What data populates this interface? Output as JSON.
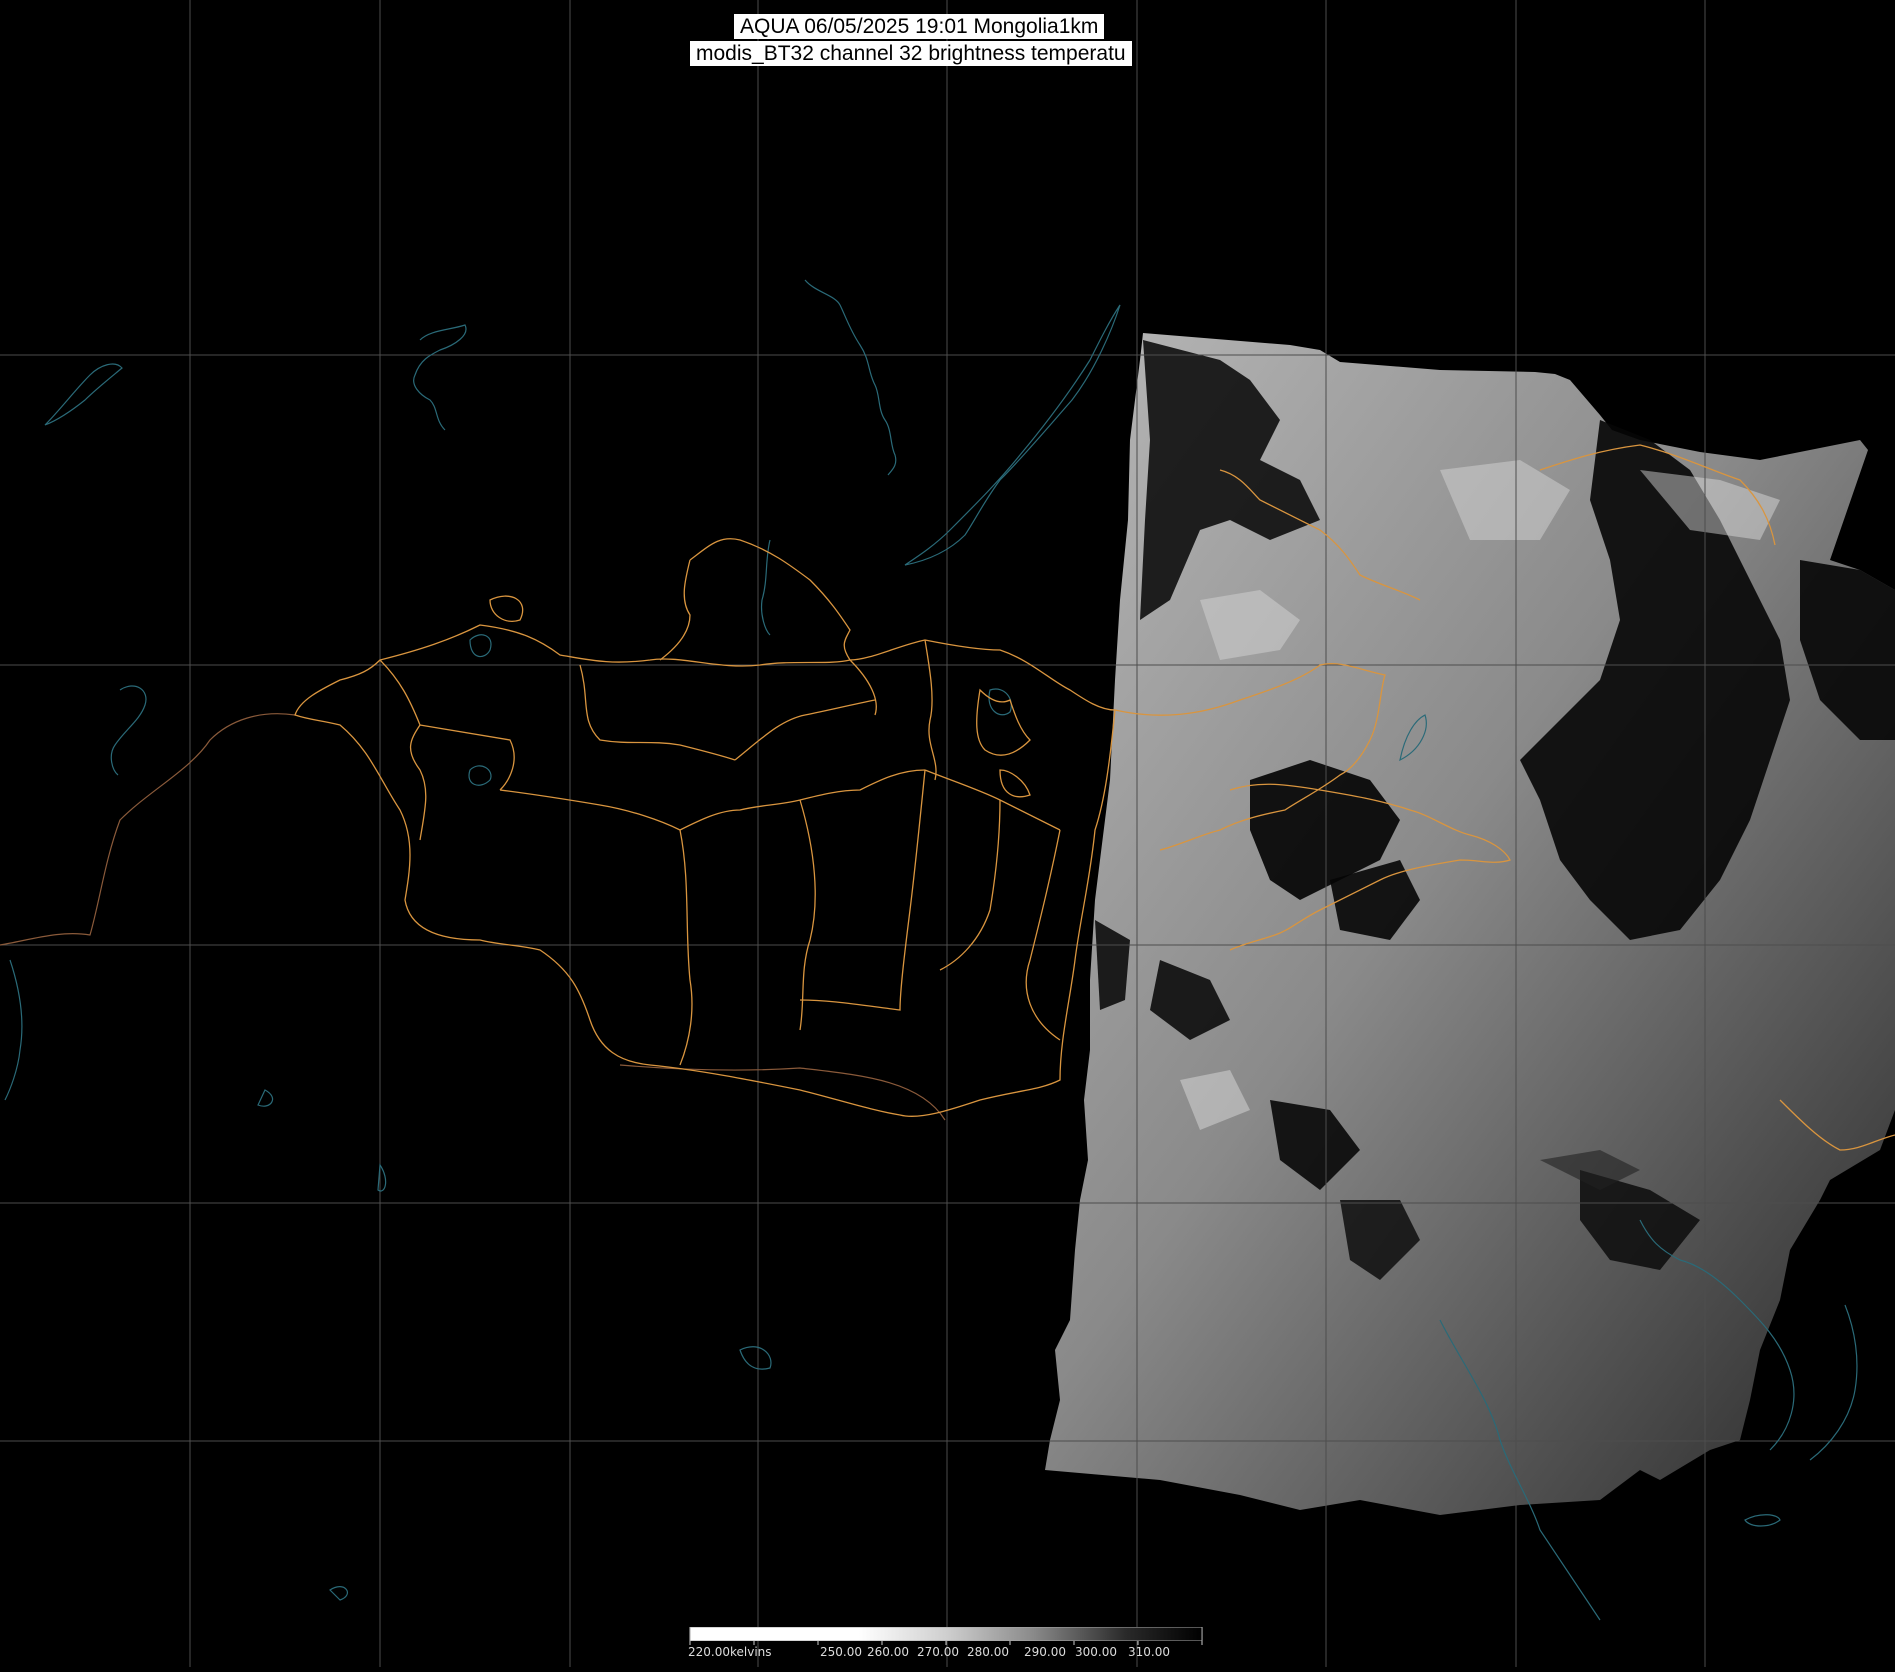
{
  "title": {
    "line1": "AQUA 06/05/2025 19:01 Mongolia1km",
    "line2": "modis_BT32 channel 32 brightness temperatu"
  },
  "colorbar": {
    "unit": "kelvins",
    "labels": [
      "220.00kelvins",
      "250.00",
      "260.00",
      "270.00",
      "280.00",
      "290.00",
      "300.00",
      "310.00"
    ],
    "min": 220,
    "max": 310,
    "gradient_colors": [
      "#ffffff",
      "#000000"
    ]
  },
  "colors": {
    "background": "#000000",
    "gridlines": "#555555",
    "admin_borders": "#d9953f",
    "coastlines_lakes": "#2a6a78"
  }
}
